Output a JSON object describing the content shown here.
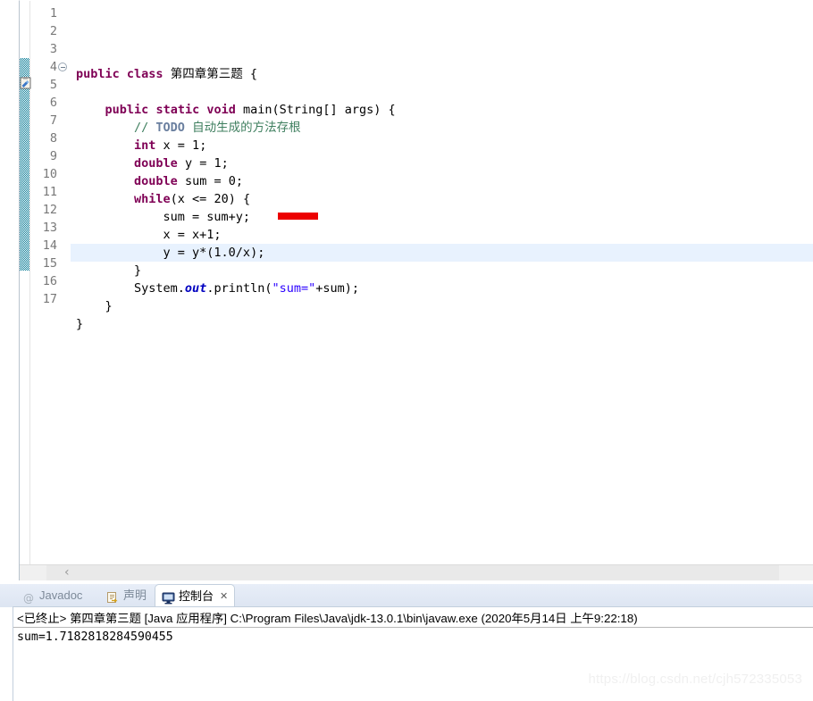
{
  "editor": {
    "current_line": 12,
    "gutter": {
      "fold_marker_line": 4,
      "todo_marker_line": 5,
      "todo_marker_icon": "task-todo-icon",
      "fold_icon": "collapse-circle-minus-icon"
    },
    "line_numbers": [
      "1",
      "2",
      "3",
      "4",
      "5",
      "6",
      "7",
      "8",
      "9",
      "10",
      "11",
      "12",
      "13",
      "14",
      "15",
      "16",
      "17"
    ],
    "lines": [
      {
        "n": 1,
        "tokens": []
      },
      {
        "n": 2,
        "tokens": [
          {
            "t": "kw",
            "s": "public"
          },
          {
            "t": "plain",
            "s": " "
          },
          {
            "t": "kw",
            "s": "class"
          },
          {
            "t": "plain",
            "s": " 第四章第三题 {"
          }
        ]
      },
      {
        "n": 3,
        "tokens": []
      },
      {
        "n": 4,
        "tokens": [
          {
            "t": "plain",
            "s": "    "
          },
          {
            "t": "kw",
            "s": "public"
          },
          {
            "t": "plain",
            "s": " "
          },
          {
            "t": "kw",
            "s": "static"
          },
          {
            "t": "plain",
            "s": " "
          },
          {
            "t": "kw",
            "s": "void"
          },
          {
            "t": "plain",
            "s": " main(String[] args) {"
          }
        ]
      },
      {
        "n": 5,
        "tokens": [
          {
            "t": "plain",
            "s": "        "
          },
          {
            "t": "cmt",
            "s": "// "
          },
          {
            "t": "todo",
            "s": "TODO"
          },
          {
            "t": "cmt",
            "s": " 自动生成的方法存根"
          }
        ]
      },
      {
        "n": 6,
        "tokens": [
          {
            "t": "plain",
            "s": "        "
          },
          {
            "t": "kw",
            "s": "int"
          },
          {
            "t": "plain",
            "s": " x = 1;"
          }
        ]
      },
      {
        "n": 7,
        "tokens": [
          {
            "t": "plain",
            "s": "        "
          },
          {
            "t": "kw",
            "s": "double"
          },
          {
            "t": "plain",
            "s": " y = 1;"
          }
        ]
      },
      {
        "n": 8,
        "tokens": [
          {
            "t": "plain",
            "s": "        "
          },
          {
            "t": "kw",
            "s": "double"
          },
          {
            "t": "plain",
            "s": " sum = 0;"
          }
        ]
      },
      {
        "n": 9,
        "tokens": [
          {
            "t": "plain",
            "s": "        "
          },
          {
            "t": "kw",
            "s": "while"
          },
          {
            "t": "plain",
            "s": "(x <= 20) {"
          }
        ]
      },
      {
        "n": 10,
        "tokens": [
          {
            "t": "plain",
            "s": "            sum = sum+y;"
          }
        ]
      },
      {
        "n": 11,
        "tokens": [
          {
            "t": "plain",
            "s": "            x = x+1;"
          }
        ]
      },
      {
        "n": 12,
        "tokens": [
          {
            "t": "plain",
            "s": "            y = y*(1.0/x);"
          }
        ]
      },
      {
        "n": 13,
        "tokens": [
          {
            "t": "plain",
            "s": "        }"
          }
        ]
      },
      {
        "n": 14,
        "tokens": [
          {
            "t": "plain",
            "s": "        System."
          },
          {
            "t": "sfld",
            "s": "out"
          },
          {
            "t": "plain",
            "s": ".println("
          },
          {
            "t": "str",
            "s": "\"sum=\""
          },
          {
            "t": "plain",
            "s": "+sum);"
          }
        ]
      },
      {
        "n": 15,
        "tokens": [
          {
            "t": "plain",
            "s": "    }"
          }
        ]
      },
      {
        "n": 16,
        "tokens": [
          {
            "t": "plain",
            "s": "}"
          }
        ]
      },
      {
        "n": 17,
        "tokens": []
      }
    ],
    "annotation_mark": {
      "name": "red-highlight-bar",
      "color": "#ec0000"
    },
    "scroll_left_arrow": "‹"
  },
  "bottom_view": {
    "tabs": [
      {
        "label": "Javadoc",
        "icon": "javadoc-at-icon",
        "active": false
      },
      {
        "label": "声明",
        "icon": "declaration-icon",
        "active": false
      },
      {
        "label": "控制台",
        "icon": "console-icon",
        "active": true,
        "close": "✕"
      }
    ]
  },
  "console": {
    "status_line": "<已终止> 第四章第三题 [Java 应用程序] C:\\Program Files\\Java\\jdk-13.0.1\\bin\\javaw.exe  (2020年5月14日 上午9:22:18)",
    "output": "sum=1.7182818284590455"
  },
  "watermark": {
    "text": "https://blog.csdn.net/cjh572335053"
  },
  "colors": {
    "keyword": "#7f0055",
    "comment": "#3f7f5f",
    "string": "#2a00ff",
    "static_field": "#0000c0",
    "todo_tag": "#6a7f9f",
    "current_line_bg": "#e8f2fe",
    "change_bar": "#0f7f99",
    "red_mark": "#ec0000"
  }
}
